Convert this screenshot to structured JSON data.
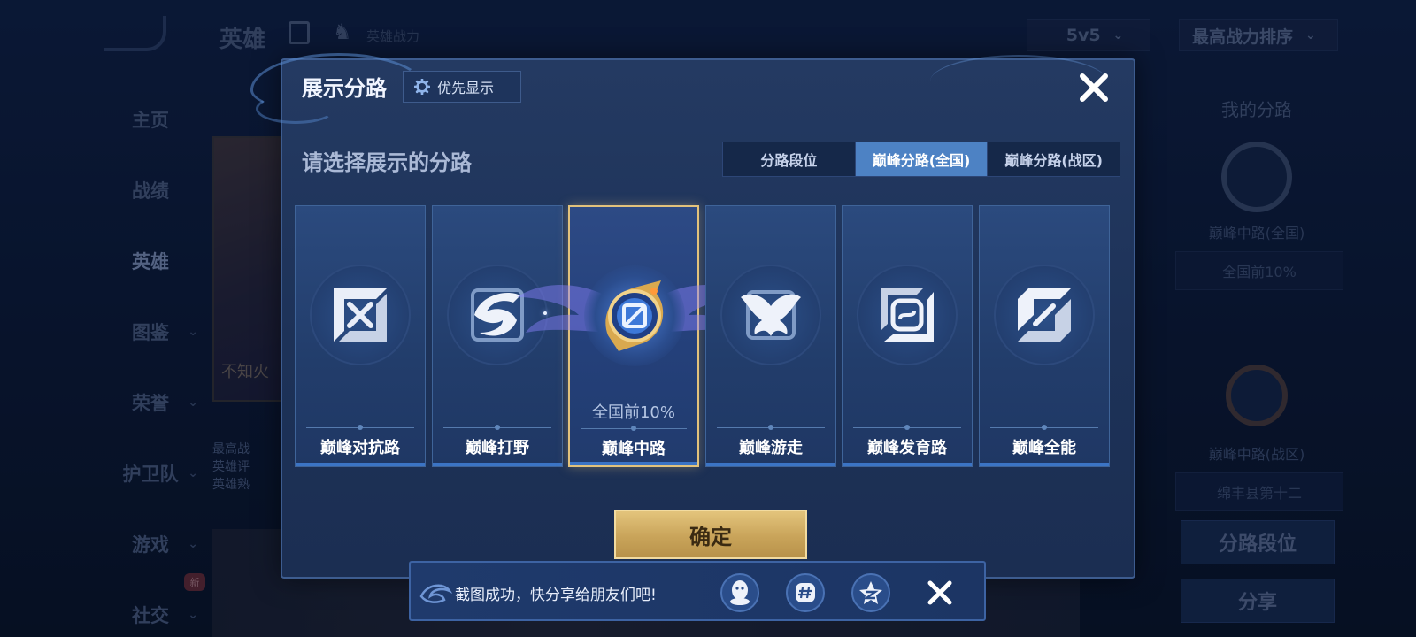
{
  "background": {
    "header_title": "英雄",
    "header_power_label": "英雄战力",
    "mode_select": "5v5",
    "sort_select": "最高战力排序",
    "nav_items": [
      "主页",
      "战绩",
      "英雄",
      "图鉴",
      "荣誉",
      "护卫队",
      "游戏",
      "社交"
    ],
    "active_nav": "英雄",
    "new_badge": "新",
    "card_text": "不知火",
    "card_note": [
      "最高战",
      "英雄评",
      "英雄熟"
    ],
    "right_panel": {
      "title": "我的分路",
      "emblem1_label": "巅峰中路(全国)",
      "emblem1_value": "全国前10%",
      "emblem2_label": "巅峰中路(战区)",
      "emblem2_value": "绵丰县第十二",
      "btn1": "分路段位",
      "btn2": "分享"
    }
  },
  "modal": {
    "title": "展示分路",
    "priority_button": "优先显示",
    "section_label": "请选择展示的分路",
    "tabs": [
      {
        "label": "分路段位",
        "active": false
      },
      {
        "label": "巅峰分路(全国)",
        "active": true
      },
      {
        "label": "巅峰分路(战区)",
        "active": false
      }
    ],
    "lanes": [
      {
        "name": "巅峰对抗路",
        "icon": "clash-lane-icon",
        "selected": false
      },
      {
        "name": "巅峰打野",
        "icon": "jungle-icon",
        "selected": false
      },
      {
        "name": "巅峰中路",
        "icon": "mid-lane-emblem-icon",
        "selected": true,
        "rank": "全国前10%"
      },
      {
        "name": "巅峰游走",
        "icon": "roam-icon",
        "selected": false
      },
      {
        "name": "巅峰发育路",
        "icon": "farm-lane-icon",
        "selected": false
      },
      {
        "name": "巅峰全能",
        "icon": "all-round-icon",
        "selected": false
      }
    ],
    "confirm_button": "确定"
  },
  "toast": {
    "message": "截图成功，快分享给朋友们吧!",
    "share_targets": [
      "qq-icon",
      "tag-icon",
      "qzone-icon"
    ]
  },
  "colors": {
    "accent_blue": "#4d82c4",
    "gold": "#e2c27c",
    "modal_bg": "#1d3258"
  }
}
